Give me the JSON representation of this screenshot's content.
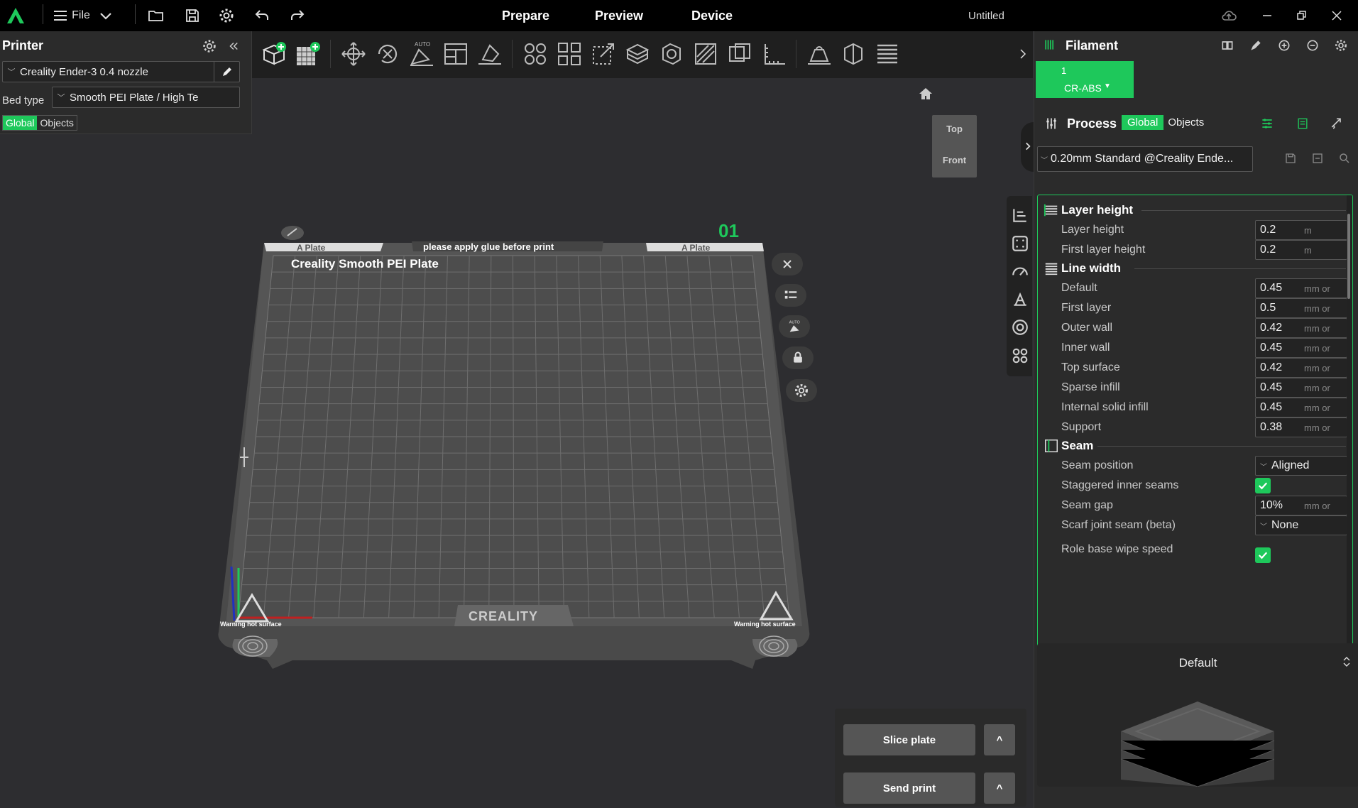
{
  "topbar": {
    "file_label": "File",
    "tabs": [
      "Prepare",
      "Preview",
      "Device"
    ],
    "doc_title": "Untitled"
  },
  "printer": {
    "title": "Printer",
    "selected_printer": "Creality Ender-3 0.4 nozzle",
    "bed_type_label": "Bed type",
    "bed_type_value": "Smooth PEI Plate / High Te",
    "toggle": [
      "Global",
      "Objects"
    ]
  },
  "plate": {
    "number": "01",
    "left_label": "A Plate",
    "right_label": "A Plate",
    "glue_note": "please apply glue before print",
    "brand_text": "Creality Smooth PEI Plate",
    "logo_text": "CREALITY",
    "warning_left": "Warning hot surface",
    "warning_right": "Warning hot surface"
  },
  "view_cube": {
    "top": "Top",
    "front": "Front"
  },
  "filament": {
    "title": "Filament",
    "slot_number": "1",
    "slot_name": "CR-ABS"
  },
  "process": {
    "title": "Process",
    "toggle": [
      "Global",
      "Objects"
    ],
    "preset": "0.20mm Standard @Creality Ende..."
  },
  "settings": {
    "sections": [
      {
        "title": "Layer height",
        "rows": [
          {
            "label": "Layer height",
            "value": "0.2",
            "unit": "m"
          },
          {
            "label": "First layer height",
            "value": "0.2",
            "unit": "m"
          }
        ]
      },
      {
        "title": "Line width",
        "rows": [
          {
            "label": "Default",
            "value": "0.45",
            "unit": "mm or"
          },
          {
            "label": "First layer",
            "value": "0.5",
            "unit": "mm or"
          },
          {
            "label": "Outer wall",
            "value": "0.42",
            "unit": "mm or"
          },
          {
            "label": "Inner wall",
            "value": "0.45",
            "unit": "mm or"
          },
          {
            "label": "Top surface",
            "value": "0.42",
            "unit": "mm or"
          },
          {
            "label": "Sparse infill",
            "value": "0.45",
            "unit": "mm or"
          },
          {
            "label": "Internal solid infill",
            "value": "0.45",
            "unit": "mm or"
          },
          {
            "label": "Support",
            "value": "0.38",
            "unit": "mm or"
          }
        ]
      },
      {
        "title": "Seam",
        "rows": [
          {
            "label": "Seam position",
            "value": "Aligned",
            "type": "select"
          },
          {
            "label": "Staggered inner seams",
            "value": "checked",
            "type": "checkbox"
          },
          {
            "label": "Seam gap",
            "value": "10%",
            "unit": "mm or"
          },
          {
            "label": "Scarf joint seam (beta)",
            "value": "None",
            "type": "select"
          },
          {
            "label": "Role base wipe speed",
            "value": "checked",
            "type": "checkbox"
          }
        ]
      }
    ]
  },
  "preview": {
    "label": "Default"
  },
  "actions": {
    "slice": "Slice plate",
    "send": "Send print",
    "caret": "^"
  },
  "colors": {
    "accent": "#1ec85b",
    "panel": "#2b2b2b",
    "viewport": "#2d2d30"
  }
}
